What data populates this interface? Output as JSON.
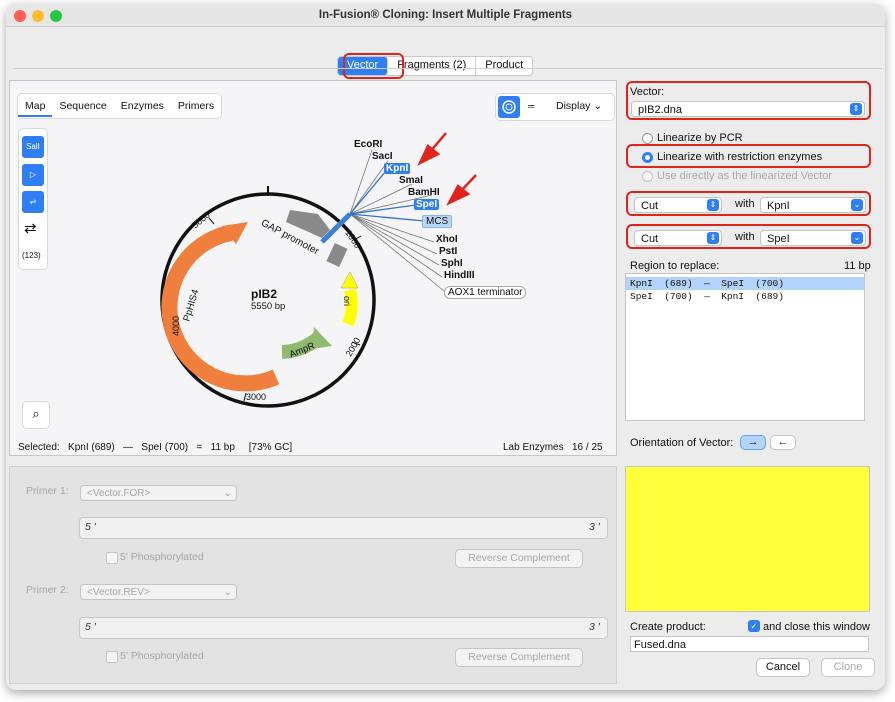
{
  "window": {
    "title": "In-Fusion® Cloning: Insert Multiple Fragments"
  },
  "tabs": [
    {
      "label": "Vector",
      "selected": true
    },
    {
      "label": "Fragments (2)",
      "selected": false
    },
    {
      "label": "Product",
      "selected": false
    }
  ],
  "map_panel": {
    "subtabs": [
      "Map",
      "Sequence",
      "Enzymes",
      "Primers"
    ],
    "display_label": "Display",
    "tool_count": "(123)"
  },
  "map": {
    "name": "pIB2",
    "length": "5550 bp",
    "ticks": [
      "1000",
      "2000",
      "3000",
      "4000",
      "5000"
    ],
    "features": [
      "GAP promoter",
      "PpHIS4",
      "ori",
      "AmpR"
    ],
    "sites_top": [
      "EcoRI",
      "SacI",
      "KpnI",
      "SmaI",
      "BamHI",
      "SpeI",
      "MCS"
    ],
    "sites_bottom": [
      "XhoI",
      "PstI",
      "SphI",
      "HindIII"
    ],
    "terminator": "AOX1 terminator"
  },
  "status": {
    "selected": "Selected:   KpnI (689)   —   SpeI (700)   =   11 bp     [73% GC]",
    "lab": "Lab Enzymes",
    "count": "16 / 25"
  },
  "vector": {
    "label": "Vector:",
    "value": "pIB2.dna",
    "options": [
      "Linearize by PCR",
      "Linearize with restriction enzymes",
      "Use directly as the linearized Vector"
    ],
    "selected_option": 1,
    "cut1": {
      "action": "Cut",
      "with": "with",
      "enzyme": "KpnI"
    },
    "cut2": {
      "action": "Cut",
      "with": "with",
      "enzyme": "SpeI"
    }
  },
  "region": {
    "label": "Region to replace:",
    "size": "11 bp",
    "rows": [
      "KpnI  (689)  —  SpeI  (700)",
      "SpeI  (700)  —  KpnI  (689)"
    ]
  },
  "orientation": {
    "label": "Orientation of Vector:",
    "forward": "→",
    "reverse": "←"
  },
  "product": {
    "create_label": "Create product:",
    "close_label": "and close this window",
    "filename": "Fused.dna",
    "cancel": "Cancel",
    "clone": "Clone"
  },
  "primers": {
    "p1_label": "Primer 1:",
    "p1_value": "<Vector.FOR>",
    "p2_label": "Primer 2:",
    "p2_value": "<Vector.REV>",
    "five": "5 '",
    "three": "3 '",
    "phos": "5' Phosphorylated",
    "revcomp": "Reverse Complement"
  },
  "colors": {
    "accent": "#2f7ef5",
    "highlight": "#e0241b",
    "preview": "#ffff3c"
  }
}
